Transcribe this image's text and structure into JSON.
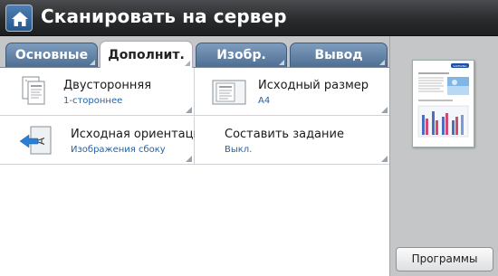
{
  "header": {
    "title": "Сканировать на сервер",
    "home_icon": "home-icon"
  },
  "tabs": [
    {
      "label": "Основные",
      "active": false
    },
    {
      "label": "Дополнит.",
      "active": true
    },
    {
      "label": "Изобр.",
      "active": false
    },
    {
      "label": "Вывод",
      "active": false
    }
  ],
  "options": {
    "duplex": {
      "title": "Двусторонняя",
      "value": "1-стороннее",
      "icon": "duplex-document-icon"
    },
    "original_size": {
      "title": "Исходный размер",
      "value": "A4",
      "icon": "original-size-icon"
    },
    "original_orientation": {
      "title": "Исходная ориентация",
      "value": "Изображения сбоку",
      "icon": "orientation-icon"
    },
    "build_job": {
      "title": "Составить задание",
      "value": "Выкл."
    }
  },
  "preview": {
    "brand": "SAMSUNG"
  },
  "programs_button": {
    "label": "Программы"
  },
  "colors": {
    "accent": "#1f63ad",
    "tab_bg": "#5a7ca3",
    "header_bg": "#2a2b2d"
  }
}
